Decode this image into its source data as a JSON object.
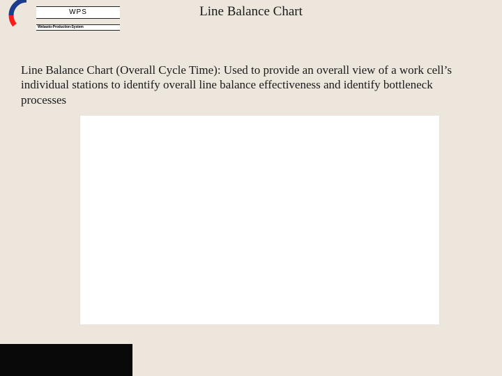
{
  "logo": {
    "abbrev": "WPS",
    "subtitle": "Webasto-Production-System"
  },
  "page": {
    "title": "Line Balance Chart",
    "description": "Line Balance Chart (Overall Cycle Time):  Used to provide an overall view of a work cell’s individual stations to identify overall line balance effectiveness and identify bottleneck processes"
  },
  "colors": {
    "background": "#ece6dc",
    "panel": "#ffffff",
    "text": "#1a1a1a",
    "arc_blue": "#1d3b8b",
    "arc_red": "#ff1a1a",
    "footer_dark": "#090909"
  }
}
